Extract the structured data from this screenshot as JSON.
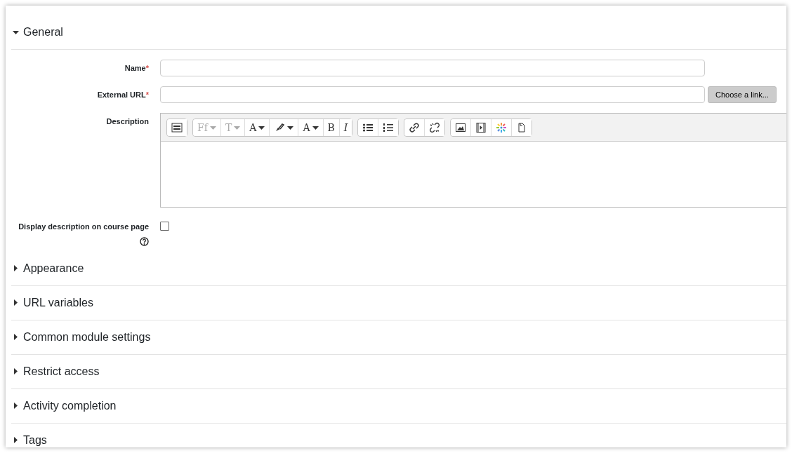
{
  "sections": [
    {
      "title": "General",
      "expanded": true
    },
    {
      "title": "Appearance",
      "expanded": false
    },
    {
      "title": "URL variables",
      "expanded": false
    },
    {
      "title": "Common module settings",
      "expanded": false
    },
    {
      "title": "Restrict access",
      "expanded": false
    },
    {
      "title": "Activity completion",
      "expanded": false
    },
    {
      "title": "Tags",
      "expanded": false
    }
  ],
  "fields": [
    {
      "kind": "text",
      "label": "Name",
      "required_mark": "*"
    },
    {
      "kind": "url",
      "label": "External URL",
      "required_mark": "*",
      "button": "Choose a link..."
    },
    {
      "kind": "editor",
      "label": "Description"
    },
    {
      "kind": "checkbox",
      "label": "Display description on course page",
      "checked": false,
      "help": true
    }
  ],
  "toolbar": [
    [
      {
        "kind": "icon",
        "dropdown": false
      }
    ],
    [
      {
        "kind": "glyph",
        "glyph": "Ff",
        "dropdown": true,
        "disabled": true
      },
      {
        "kind": "glyph",
        "glyph": "T",
        "dropdown": true,
        "disabled": true
      },
      {
        "kind": "glyph",
        "glyph": "A",
        "dropdown": true,
        "disabled": false
      },
      {
        "kind": "icon",
        "dropdown": true
      },
      {
        "kind": "glyph",
        "glyph": "A",
        "dropdown": true,
        "disabled": false
      },
      {
        "kind": "glyph",
        "glyph": "B",
        "dropdown": false,
        "disabled": false
      },
      {
        "kind": "glyph",
        "glyph": "I",
        "dropdown": false,
        "disabled": false
      }
    ],
    [
      {
        "kind": "icon",
        "dropdown": false
      },
      {
        "kind": "icon",
        "dropdown": false
      }
    ],
    [
      {
        "kind": "icon",
        "dropdown": false
      },
      {
        "kind": "icon",
        "dropdown": false
      }
    ],
    [
      {
        "kind": "icon",
        "dropdown": false
      },
      {
        "kind": "icon",
        "dropdown": false
      },
      {
        "kind": "icon",
        "dropdown": false
      },
      {
        "kind": "icon",
        "dropdown": false
      }
    ]
  ]
}
